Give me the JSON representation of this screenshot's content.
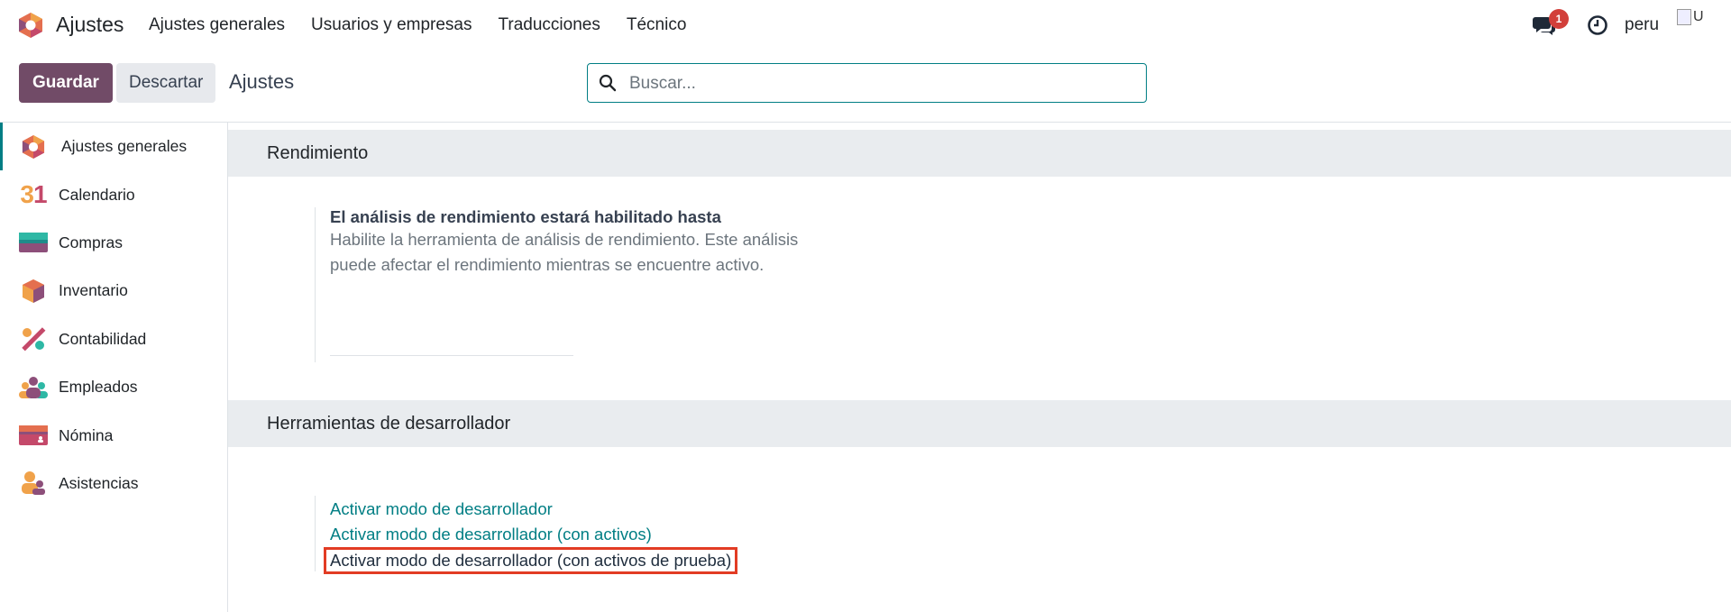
{
  "topbar": {
    "app_title": "Ajustes",
    "menu": [
      "Ajustes generales",
      "Usuarios y empresas",
      "Traducciones",
      "Técnico"
    ],
    "chat_badge": "1",
    "user_name": "peru",
    "avatar_alt": "U"
  },
  "controlbar": {
    "save_label": "Guardar",
    "discard_label": "Descartar",
    "breadcrumb": "Ajustes",
    "search_placeholder": "Buscar..."
  },
  "sidebar": {
    "items": [
      {
        "label": "Ajustes generales",
        "icon": "odoo-logo-icon"
      },
      {
        "label": "Calendario",
        "icon": "calendar-icon"
      },
      {
        "label": "Compras",
        "icon": "purchase-card-icon"
      },
      {
        "label": "Inventario",
        "icon": "inventory-box-icon"
      },
      {
        "label": "Contabilidad",
        "icon": "accounting-icon"
      },
      {
        "label": "Empleados",
        "icon": "employees-icon"
      },
      {
        "label": "Nómina",
        "icon": "payroll-icon"
      },
      {
        "label": "Asistencias",
        "icon": "attendance-icon"
      }
    ],
    "calendar_number": "31"
  },
  "sections": {
    "performance": {
      "title": "Rendimiento",
      "setting_title": "El análisis de rendimiento estará habilitado hasta",
      "setting_desc": "Habilite la herramienta de análisis de rendimiento. Este análisis puede afectar el rendimiento mientras se encuentre activo."
    },
    "developer": {
      "title": "Herramientas de desarrollador",
      "links": [
        "Activar modo de desarrollador",
        "Activar modo de desarrollador (con activos)",
        "Activar modo de desarrollador (con activos de prueba)"
      ]
    }
  },
  "colors": {
    "brand": "#714b67",
    "accent": "#017e84",
    "highlight_box": "#e23c24"
  }
}
